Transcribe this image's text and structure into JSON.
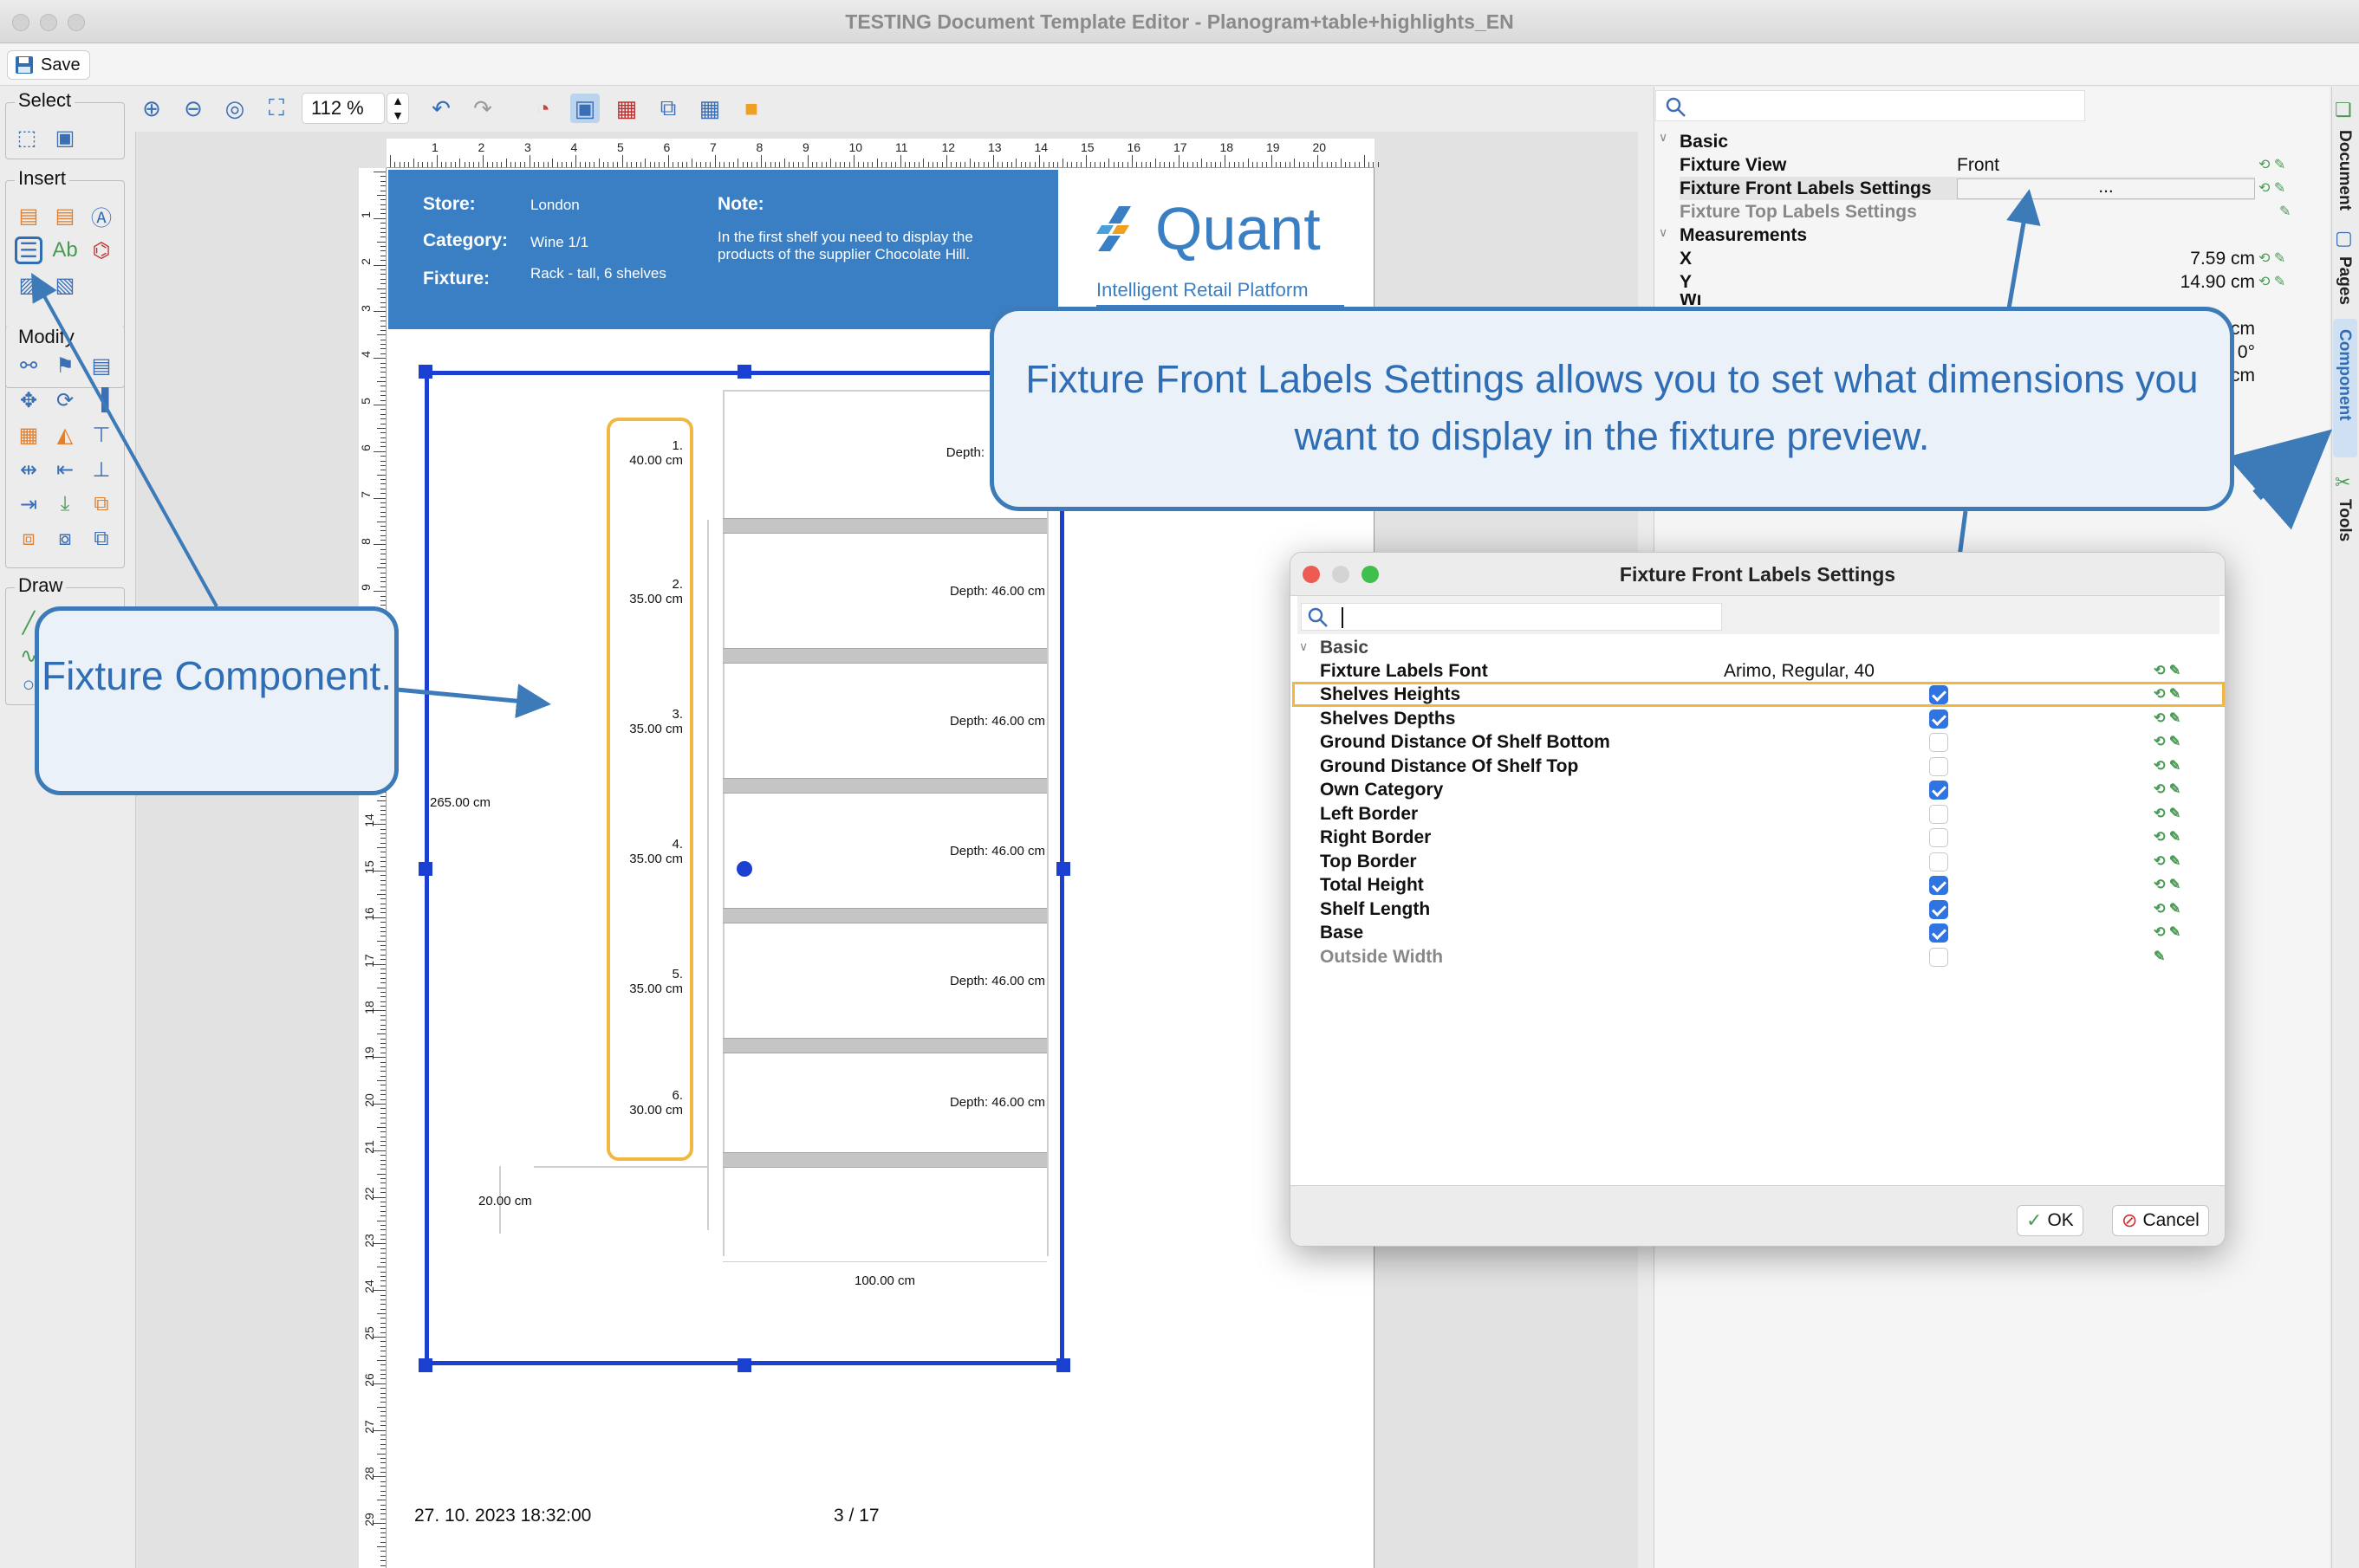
{
  "window": {
    "title": "TESTING Document Template Editor - Planogram+table+highlights_EN"
  },
  "savebar": {
    "save_label": "Save"
  },
  "toolbar": {
    "zoom_value": "112 %"
  },
  "left_tools": {
    "select": "Select",
    "insert": "Insert",
    "modify": "Modify",
    "draw": "Draw"
  },
  "page": {
    "header": {
      "store_label": "Store:",
      "store_value": "London",
      "category_label": "Category:",
      "category_value": "Wine 1/1",
      "fixture_label": "Fixture:",
      "fixture_value": "Rack - tall, 6 shelves",
      "note_label": "Note:",
      "note_value": "In the first shelf you need to display the products of the supplier Chocolate Hill."
    },
    "logo": {
      "name": "Quant",
      "tagline": "Intelligent Retail Platform"
    },
    "fixture": {
      "total_height": "265.00 cm",
      "base_height": "20.00 cm",
      "shelf_length": "100.00 cm",
      "shelves": [
        {
          "num": "1.",
          "height": "40.00 cm",
          "depth": "Depth:"
        },
        {
          "num": "2.",
          "height": "35.00 cm",
          "depth": "Depth:  46.00 cm"
        },
        {
          "num": "3.",
          "height": "35.00 cm",
          "depth": "Depth:  46.00 cm"
        },
        {
          "num": "4.",
          "height": "35.00 cm",
          "depth": "Depth:  46.00 cm"
        },
        {
          "num": "5.",
          "height": "35.00 cm",
          "depth": "Depth:  46.00 cm"
        },
        {
          "num": "6.",
          "height": "30.00 cm",
          "depth": "Depth:  46.00 cm"
        }
      ]
    },
    "footer": {
      "date": "27. 10. 2023 18:32:00",
      "page_no": "3 / 17"
    }
  },
  "right_panel": {
    "section_basic": "Basic",
    "fixture_view_label": "Fixture View",
    "fixture_view_value": "Front",
    "front_labels_label": "Fixture Front Labels Settings",
    "front_labels_value": "...",
    "top_labels_label": "Fixture Top Labels Settings",
    "section_measurements": "Measurements",
    "x_label": "X",
    "x_value": "7.59 cm",
    "y_label": "Y",
    "y_value": "14.90 cm",
    "w_partial": "Wi",
    "partial_1": "cm",
    "partial_2": "0°",
    "partial_3": "cm"
  },
  "side_tabs": [
    "Document",
    "Pages",
    "Component",
    "Tools"
  ],
  "callouts": {
    "main": "Fixture Front Labels Settings allows you to set what dimensions you want to display in the fixture preview.",
    "fixture": "Fixture Component."
  },
  "dialog": {
    "title": "Fixture Front Labels Settings",
    "section": "Basic",
    "font_label": "Fixture Labels Font",
    "font_value": "Arimo, Regular, 40",
    "rows": [
      {
        "label": "Shelves Heights",
        "checked": true
      },
      {
        "label": "Shelves Depths",
        "checked": true
      },
      {
        "label": "Ground Distance Of Shelf Bottom",
        "checked": false
      },
      {
        "label": "Ground Distance Of Shelf Top",
        "checked": false
      },
      {
        "label": "Own Category",
        "checked": true
      },
      {
        "label": "Left Border",
        "checked": false
      },
      {
        "label": "Right Border",
        "checked": false
      },
      {
        "label": "Top Border",
        "checked": false
      },
      {
        "label": "Total Height",
        "checked": true
      },
      {
        "label": "Shelf Length",
        "checked": true
      },
      {
        "label": "Base",
        "checked": true
      },
      {
        "label": "Outside Width",
        "checked": false
      }
    ],
    "ok_label": "OK",
    "cancel_label": "Cancel"
  },
  "colors": {
    "accent": "#3a7fc3",
    "selection": "#1a3fd1",
    "highlight": "#f0b842",
    "callout_border": "#3d7ab8"
  }
}
